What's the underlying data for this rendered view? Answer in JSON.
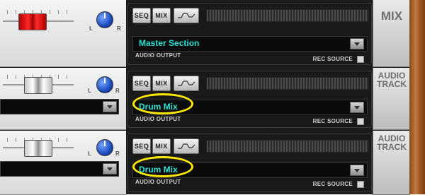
{
  "colors": {
    "accent_text": "#29e0d4",
    "highlight_ring": "#ffea00",
    "fader_master": "#ff2a2a",
    "knob": "#1b4bbf"
  },
  "channels": [
    {
      "type_label": "MIX",
      "seq_label": "SEQ",
      "mix_label": "MIX",
      "output_name": "Master Section",
      "output_caption": "AUDIO OUTPUT",
      "rec_source_label": "REC SOURCE",
      "pan_left": "L",
      "pan_right": "R",
      "fader_icon": "red-fader-icon",
      "highlighted": false
    },
    {
      "type_label_line1": "AUDIO",
      "type_label_line2": "TRACK",
      "seq_label": "SEQ",
      "mix_label": "MIX",
      "output_name": "Drum Mix",
      "output_caption": "AUDIO OUTPUT",
      "rec_source_label": "REC SOURCE",
      "pan_left": "L",
      "pan_right": "R",
      "fader_icon": "gray-fader-icon",
      "highlighted": true
    },
    {
      "type_label_line1": "AUDIO",
      "type_label_line2": "TRACK",
      "seq_label": "SEQ",
      "mix_label": "MIX",
      "output_name": "Drum Mix",
      "output_caption": "AUDIO OUTPUT",
      "rec_source_label": "REC SOURCE",
      "pan_left": "L",
      "pan_right": "R",
      "fader_icon": "gray-fader-icon",
      "highlighted": true
    }
  ]
}
